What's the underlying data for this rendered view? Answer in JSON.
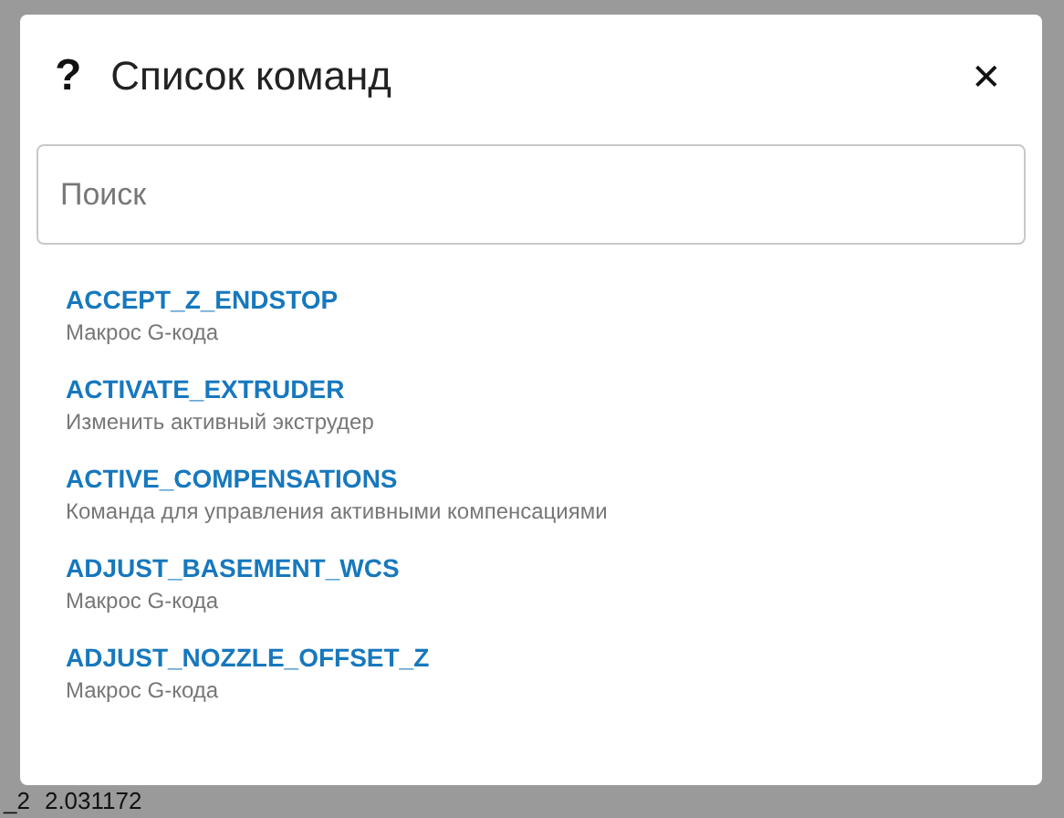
{
  "background": {
    "texts": [
      "_2",
      "2.031172"
    ]
  },
  "dialog": {
    "icon_text": "?",
    "title": "Список команд",
    "close_text": "✕",
    "search": {
      "placeholder": "Поиск"
    },
    "commands": [
      {
        "name": "ACCEPT_Z_ENDSTOP",
        "description": "Макрос G-кода"
      },
      {
        "name": "ACTIVATE_EXTRUDER",
        "description": "Изменить активный экструдер"
      },
      {
        "name": "ACTIVE_COMPENSATIONS",
        "description": "Команда для управления активными компенсациями"
      },
      {
        "name": "ADJUST_BASEMENT_WCS",
        "description": "Макрос G-кода"
      },
      {
        "name": "ADJUST_NOZZLE_OFFSET_Z",
        "description": "Макрос G-кода"
      }
    ]
  }
}
